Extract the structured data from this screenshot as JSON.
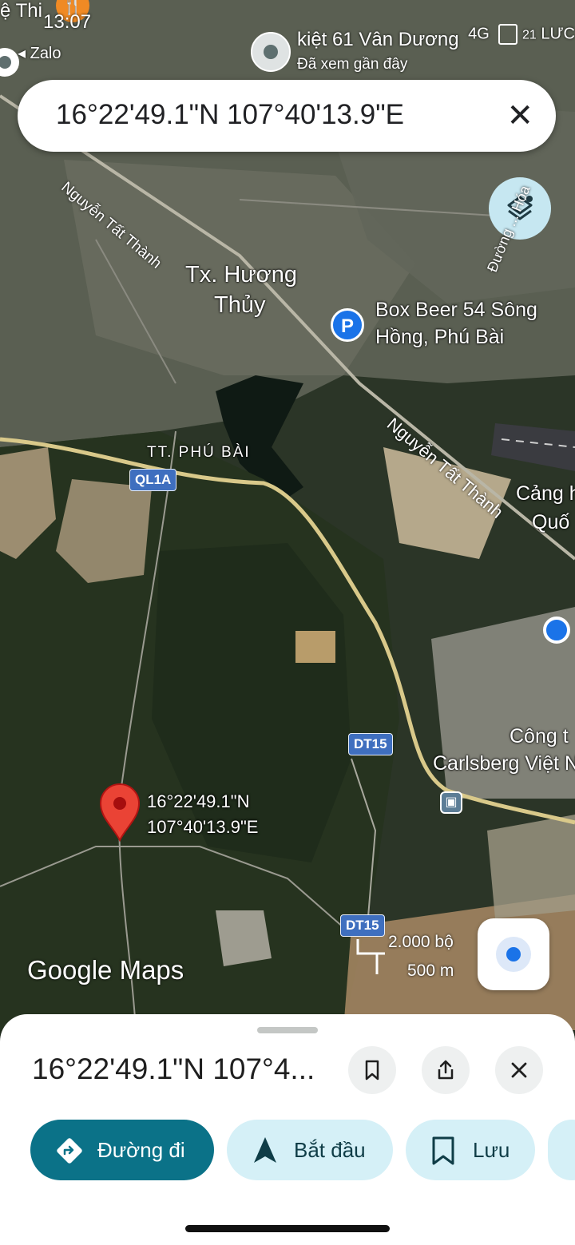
{
  "status_bar": {
    "left_text": "ệ Thi",
    "time": "13:07",
    "back_app": "◂ Zalo",
    "network": "4G",
    "battery_text": "21",
    "right_cut": "LƯC"
  },
  "recent": {
    "title": "kiệt 61 Vân Dương",
    "subtitle": "Đã xem gần đây"
  },
  "search": {
    "query": "16°22'49.1\"N 107°40'13.9\"E",
    "clear_glyph": "✕"
  },
  "map_labels": {
    "town_line1": "Tx. Hương",
    "town_line2": "Thủy",
    "tt_phu_bai": "TT. PHÚ BÀI",
    "poi_line1": "Box Beer 54 Sông",
    "poi_line2": "Hồng, Phú Bài",
    "road_nguyen_tat_thanh_1": "Nguyễn Tất Thành",
    "road_nguyen_tat_thanh_2": "Nguyễn Tất Thành",
    "road_right_top": "Đường ... Hóa",
    "airport_line1": "Cảng h",
    "airport_line2": "Quố",
    "company_line1": "Công t",
    "company_line2": "Carlsberg Việt N",
    "shield_ql1a": "QL1A",
    "shield_dt15_a": "DT15",
    "shield_dt15_b": "DT15",
    "parking_glyph": "P",
    "bus_glyph": "▣"
  },
  "marker": {
    "line1": "16°22'49.1\"N",
    "line2": "107°40'13.9\"E"
  },
  "branding": {
    "logo": "Google Maps"
  },
  "scale": {
    "imperial": "2.000 bộ",
    "metric": "500 m"
  },
  "sheet": {
    "title": "16°22'49.1\"N 107°4...",
    "actions": [
      {
        "label": "Đường đi",
        "icon": "directions-icon"
      },
      {
        "label": "Bắt đầu",
        "icon": "navigation-arrow-icon"
      },
      {
        "label": "Lưu",
        "icon": "bookmark-icon"
      }
    ]
  },
  "colors": {
    "accent": "#0b7288",
    "chip_bg": "#d5f0f7",
    "map_blue": "#1a73e8",
    "marker_red": "#ea4335"
  }
}
